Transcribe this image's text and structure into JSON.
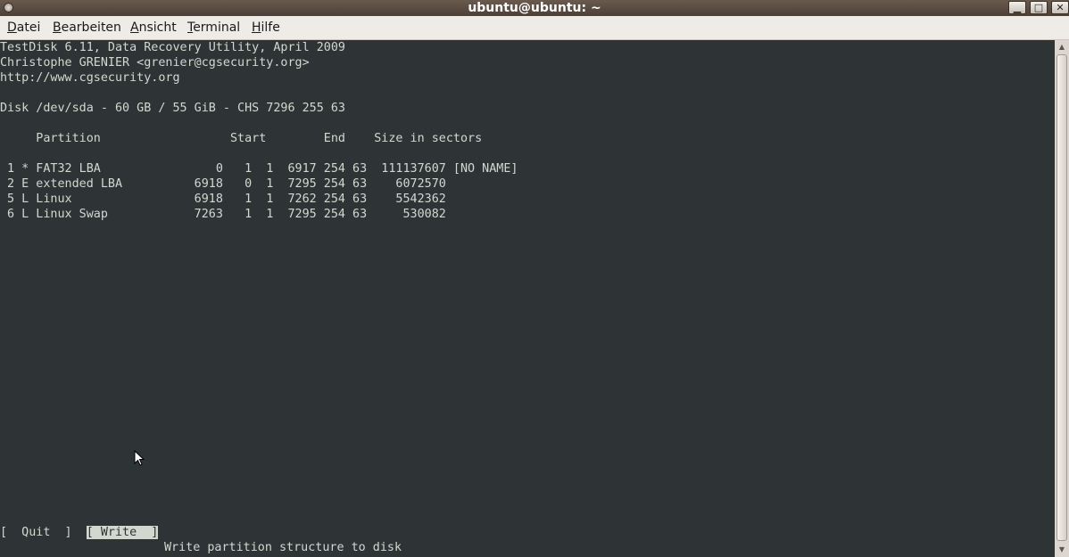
{
  "window": {
    "title": "ubuntu@ubuntu: ~",
    "controls": {
      "minimize": "▁",
      "maximize": "□",
      "close": "✕"
    }
  },
  "menubar": {
    "items": [
      {
        "mnemonic": "D",
        "rest": "atei"
      },
      {
        "mnemonic": "B",
        "rest": "earbeiten"
      },
      {
        "mnemonic": "A",
        "rest": "nsicht"
      },
      {
        "mnemonic": "T",
        "rest": "erminal"
      },
      {
        "mnemonic": "H",
        "rest": "ilfe"
      }
    ]
  },
  "terminal": {
    "header": [
      "TestDisk 6.11, Data Recovery Utility, April 2009",
      "Christophe GRENIER <grenier@cgsecurity.org>",
      "http://www.cgsecurity.org"
    ],
    "disk_line": "Disk /dev/sda - 60 GB / 55 GiB - CHS 7296 255 63",
    "column_header": "     Partition                  Start        End    Size in sectors",
    "partitions": [
      " 1 * FAT32 LBA                0   1  1  6917 254 63  111137607 [NO NAME]",
      " 2 E extended LBA          6918   0  1  7295 254 63    6072570",
      " 5 L Linux                 6918   1  1  7262 254 63    5542362",
      " 6 L Linux Swap            7263   1  1  7295 254 63     530082"
    ],
    "menu": {
      "quit": "[  Quit  ]",
      "write": "[ Write  ]",
      "description": "Write partition structure to disk"
    }
  },
  "colors": {
    "terminal_bg": "#2e3436",
    "terminal_fg": "#d3d7cf",
    "titlebar": "#5a4b41",
    "menubar": "#efebe7"
  }
}
